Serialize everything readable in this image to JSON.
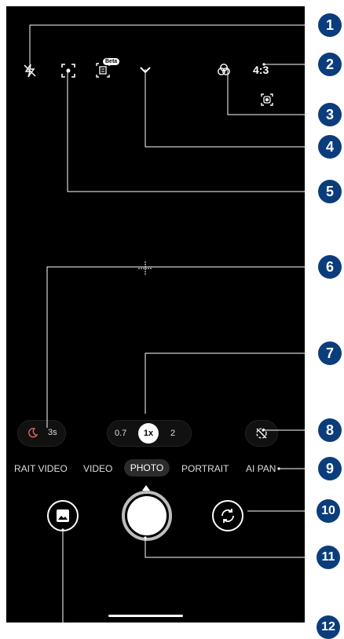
{
  "top_bar": {
    "flash_icon": "flash-off-icon",
    "focus_icon": "focus-icon",
    "beta_badge": "Beta",
    "expand_icon": "chevron-down-icon",
    "filter_icon": "filter-icon",
    "aspect_ratio": "4:3"
  },
  "side": {
    "screen_record_icon": "screen-record-icon"
  },
  "night_timer": {
    "label": "3s",
    "icon": "moon-icon"
  },
  "zoom": {
    "options": [
      "0.7",
      "1x",
      "2"
    ],
    "active": "1x"
  },
  "motion_icon": "motion-off-icon",
  "modes": {
    "items": [
      "RAIT VIDEO",
      "VIDEO",
      "PHOTO",
      "PORTRAIT",
      "AI PAN"
    ],
    "active": "PHOTO"
  },
  "bottom": {
    "gallery_icon": "gallery-icon",
    "shutter": "shutter-button",
    "switch_icon": "camera-switch-icon"
  },
  "callouts": [
    "1",
    "2",
    "3",
    "4",
    "5",
    "6",
    "7",
    "8",
    "9",
    "10",
    "11",
    "12"
  ],
  "colors": {
    "callout_bg": "#0b3d7c",
    "night_accent": "#e06a5a"
  }
}
